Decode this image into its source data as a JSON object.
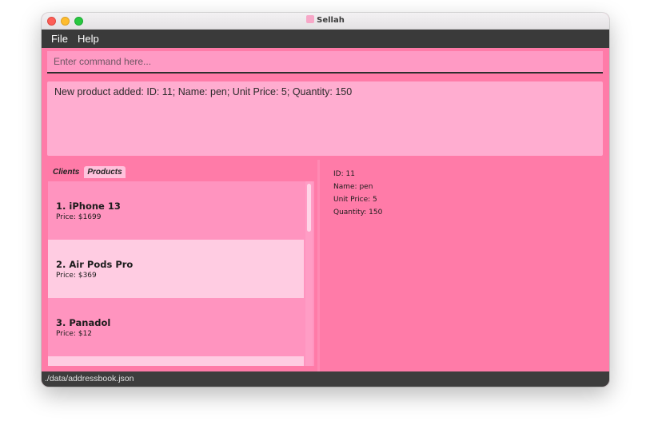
{
  "window": {
    "title": "Sellah"
  },
  "menubar": {
    "file_label": "File",
    "help_label": "Help"
  },
  "command": {
    "placeholder": "Enter command here...",
    "value": ""
  },
  "result": {
    "text": "New product added: ID: 11; Name: pen; Unit Price: 5; Quantity: 150"
  },
  "tabs": [
    {
      "label": "Clients",
      "active": false
    },
    {
      "label": "Products",
      "active": true
    }
  ],
  "products": [
    {
      "index": "1.",
      "name": "iPhone 13",
      "price": "Price: $1699"
    },
    {
      "index": "2.",
      "name": "Air Pods Pro",
      "price": "Price: $369"
    },
    {
      "index": "3.",
      "name": "Panadol",
      "price": "Price: $12"
    }
  ],
  "detail": {
    "id": "ID: 11",
    "name": "Name: pen",
    "unit_price": "Unit Price: 5",
    "quantity": "Quantity: 150"
  },
  "status": {
    "path": "./data/addressbook.json"
  },
  "colors": {
    "accent": "#ff7ba8",
    "menubar": "#3a3a3a",
    "selected_card": "#ffcce2"
  }
}
